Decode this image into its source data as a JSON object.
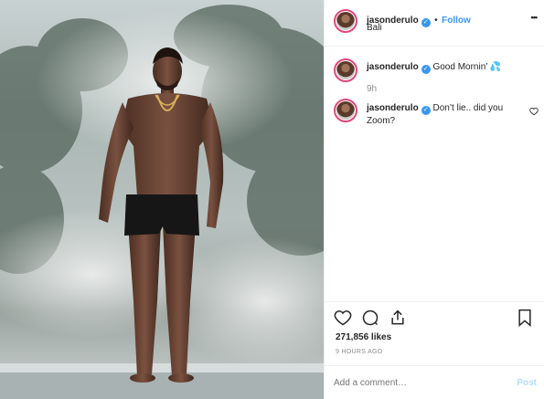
{
  "post_header": {
    "username": "jasonderulo",
    "separator": "•",
    "follow_label": "Follow",
    "location": "Bali",
    "more_glyph": "•••"
  },
  "comments": [
    {
      "username": "jasonderulo",
      "text": "Good Mornin’ 💦",
      "time": "9h"
    },
    {
      "username": "jasonderulo",
      "text_line1": "Don’t lie.. did you",
      "text_line2": "Zoom?"
    }
  ],
  "actions": {
    "likes": "271,856 likes",
    "timestamp": "9 HOURS AGO",
    "comment_placeholder": "Add a comment…",
    "post_label": "Post"
  },
  "icons": {
    "like": "heart-icon",
    "comment": "comment-bubble-icon",
    "share": "share-icon",
    "save": "bookmark-icon",
    "verified": "verified-badge-icon"
  },
  "colors": {
    "link": "#3897f0",
    "avatar_ring": "#e2487a",
    "muted": "#8e8e8e"
  }
}
